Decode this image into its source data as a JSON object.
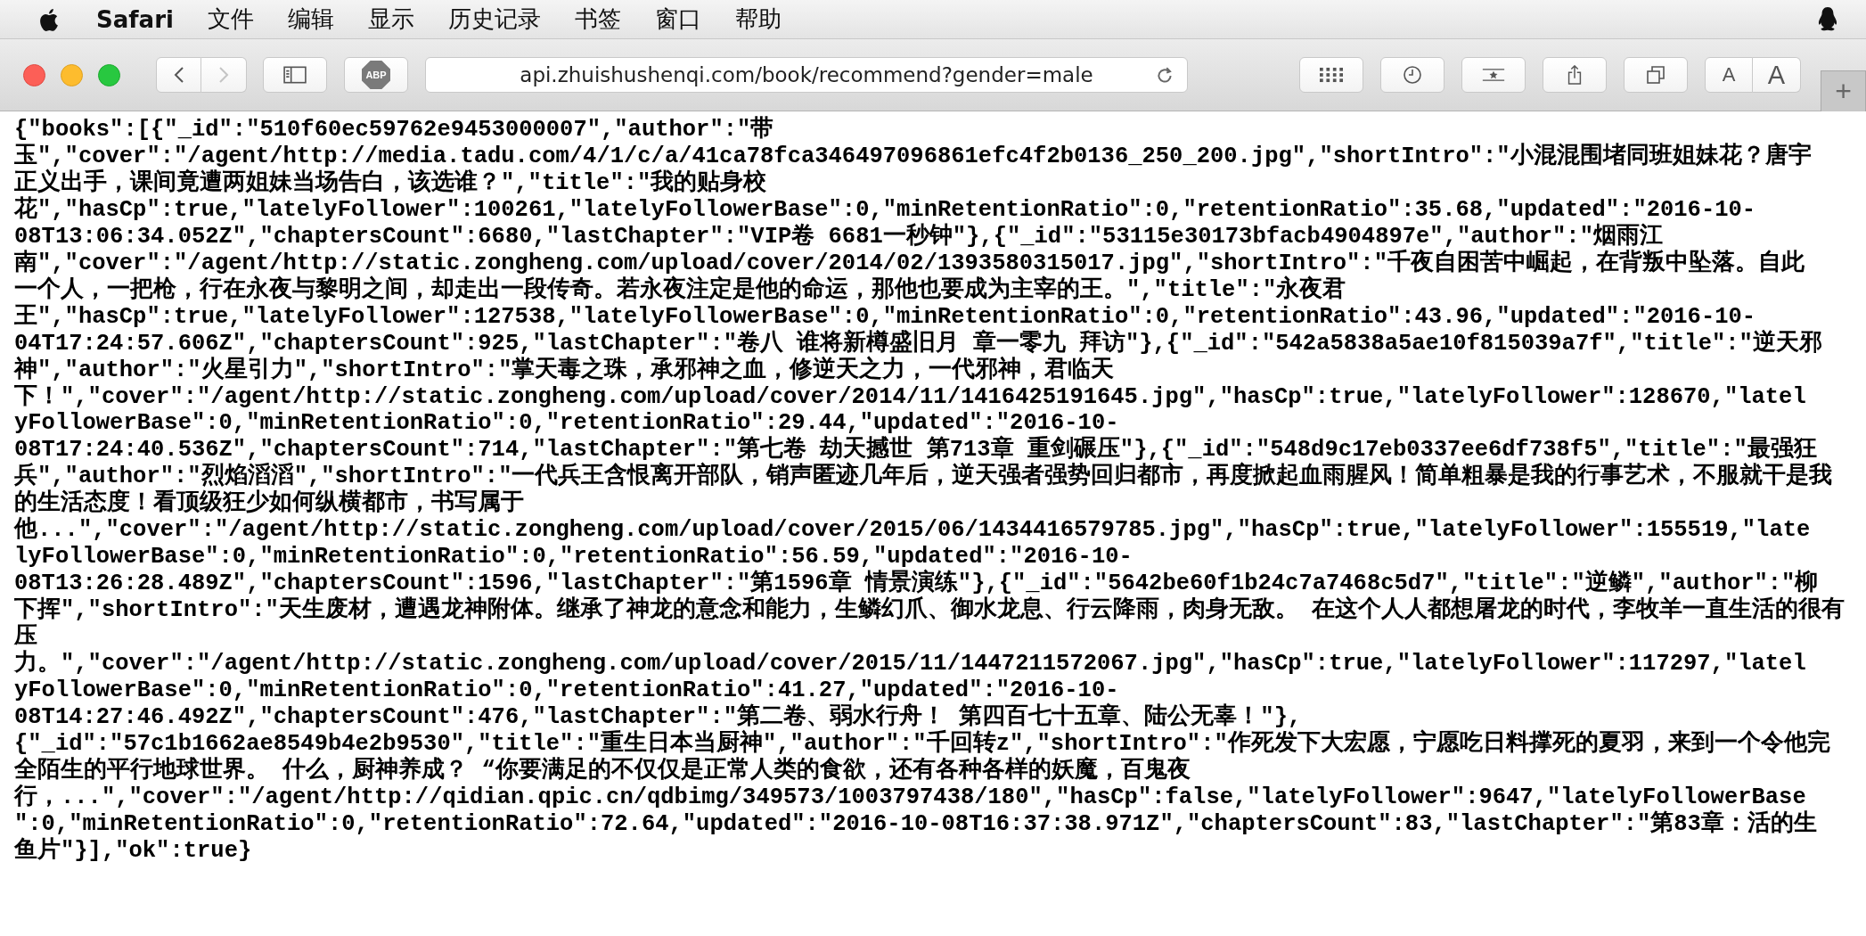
{
  "menu_bar": {
    "app": "Safari",
    "items": [
      "文件",
      "编辑",
      "显示",
      "历史记录",
      "书签",
      "窗口",
      "帮助"
    ]
  },
  "toolbar": {
    "back": {
      "disabled": false
    },
    "forward": {
      "disabled": true
    },
    "adblock_label": "ABP",
    "address": "api.zhuishushenqi.com/book/recommend?gender=male",
    "text_size_buttons": [
      "A",
      "A"
    ],
    "new_tab": "+"
  },
  "page_text_lines": [
    "{\"books\":[{\"_id\":\"510f60ec59762e9453000007\",\"author\":\"带",
    "玉\",\"cover\":\"/agent/http://media.tadu.com/4/1/c/a/41ca78fca346497096861efc4f2b0136_250_200.jpg\",\"shortIntro\":\"小混混围堵同班姐妹花？唐宇",
    "正义出手，课间竟遭两姐妹当场告白，该选谁？\",\"title\":\"我的贴身校",
    "花\",\"hasCp\":true,\"latelyFollower\":100261,\"latelyFollowerBase\":0,\"minRetentionRatio\":0,\"retentionRatio\":35.68,\"updated\":\"2016-10-",
    "08T13:06:34.052Z\",\"chaptersCount\":6680,\"lastChapter\":\"VIP卷 6681一秒钟\"},{\"_id\":\"53115e30173bfacb4904897e\",\"author\":\"烟雨江",
    "南\",\"cover\":\"/agent/http://static.zongheng.com/upload/cover/2014/02/1393580315017.jpg\",\"shortIntro\":\"千夜自困苦中崛起，在背叛中坠落。自此",
    "一个人，一把枪，行在永夜与黎明之间，却走出一段传奇。若永夜注定是他的命运，那他也要成为主宰的王。\",\"title\":\"永夜君",
    "王\",\"hasCp\":true,\"latelyFollower\":127538,\"latelyFollowerBase\":0,\"minRetentionRatio\":0,\"retentionRatio\":43.96,\"updated\":\"2016-10-",
    "04T17:24:57.606Z\",\"chaptersCount\":925,\"lastChapter\":\"卷八 谁将新樽盛旧月 章一零九 拜访\"},{\"_id\":\"542a5838a5ae10f815039a7f\",\"title\":\"逆天邪",
    "神\",\"author\":\"火星引力\",\"shortIntro\":\"掌天毒之珠，承邪神之血，修逆天之力，一代邪神，君临天",
    "下！\",\"cover\":\"/agent/http://static.zongheng.com/upload/cover/2014/11/1416425191645.jpg\",\"hasCp\":true,\"latelyFollower\":128670,\"latel",
    "yFollowerBase\":0,\"minRetentionRatio\":0,\"retentionRatio\":29.44,\"updated\":\"2016-10-",
    "08T17:24:40.536Z\",\"chaptersCount\":714,\"lastChapter\":\"第七卷 劫天撼世 第713章 重剑碾压\"},{\"_id\":\"548d9c17eb0337ee6df738f5\",\"title\":\"最强狂",
    "兵\",\"author\":\"烈焰滔滔\",\"shortIntro\":\"一代兵王含恨离开部队，销声匿迹几年后，逆天强者强势回归都市，再度掀起血雨腥风！简单粗暴是我的行事艺术，不服就干是我",
    "的生活态度！看顶级狂少如何纵横都市，书写属于",
    "他...\",\"cover\":\"/agent/http://static.zongheng.com/upload/cover/2015/06/1434416579785.jpg\",\"hasCp\":true,\"latelyFollower\":155519,\"late",
    "lyFollowerBase\":0,\"minRetentionRatio\":0,\"retentionRatio\":56.59,\"updated\":\"2016-10-",
    "08T13:26:28.489Z\",\"chaptersCount\":1596,\"lastChapter\":\"第1596章 情景演练\"},{\"_id\":\"5642be60f1b24c7a7468c5d7\",\"title\":\"逆鳞\",\"author\":\"柳",
    "下挥\",\"shortIntro\":\"天生废材，遭遇龙神附体。继承了神龙的意念和能力，生鳞幻爪、御水龙息、行云降雨，肉身无敌。 在这个人人都想屠龙的时代，李牧羊一直生活的很有",
    "压",
    "力。\",\"cover\":\"/agent/http://static.zongheng.com/upload/cover/2015/11/1447211572067.jpg\",\"hasCp\":true,\"latelyFollower\":117297,\"latel",
    "yFollowerBase\":0,\"minRetentionRatio\":0,\"retentionRatio\":41.27,\"updated\":\"2016-10-",
    "08T14:27:46.492Z\",\"chaptersCount\":476,\"lastChapter\":\"第二卷、弱水行舟！ 第四百七十五章、陆公无辜！\"},",
    "{\"_id\":\"57c1b1662ae8549b4e2b9530\",\"title\":\"重生日本当厨神\",\"author\":\"千回转z\",\"shortIntro\":\"作死发下大宏愿，宁愿吃日料撑死的夏羽，来到一个令他完",
    "全陌生的平行地球世界。 什么，厨神养成？ “你要满足的不仅仅是正常人类的食欲，还有各种各样的妖魔，百鬼夜",
    "行，...\",\"cover\":\"/agent/http://qidian.qpic.cn/qdbimg/349573/1003797438/180\",\"hasCp\":false,\"latelyFollower\":9647,\"latelyFollowerBase",
    "\":0,\"minRetentionRatio\":0,\"retentionRatio\":72.64,\"updated\":\"2016-10-08T16:37:38.971Z\",\"chaptersCount\":83,\"lastChapter\":\"第83章：活的生",
    "鱼片\"}],\"ok\":true}"
  ]
}
